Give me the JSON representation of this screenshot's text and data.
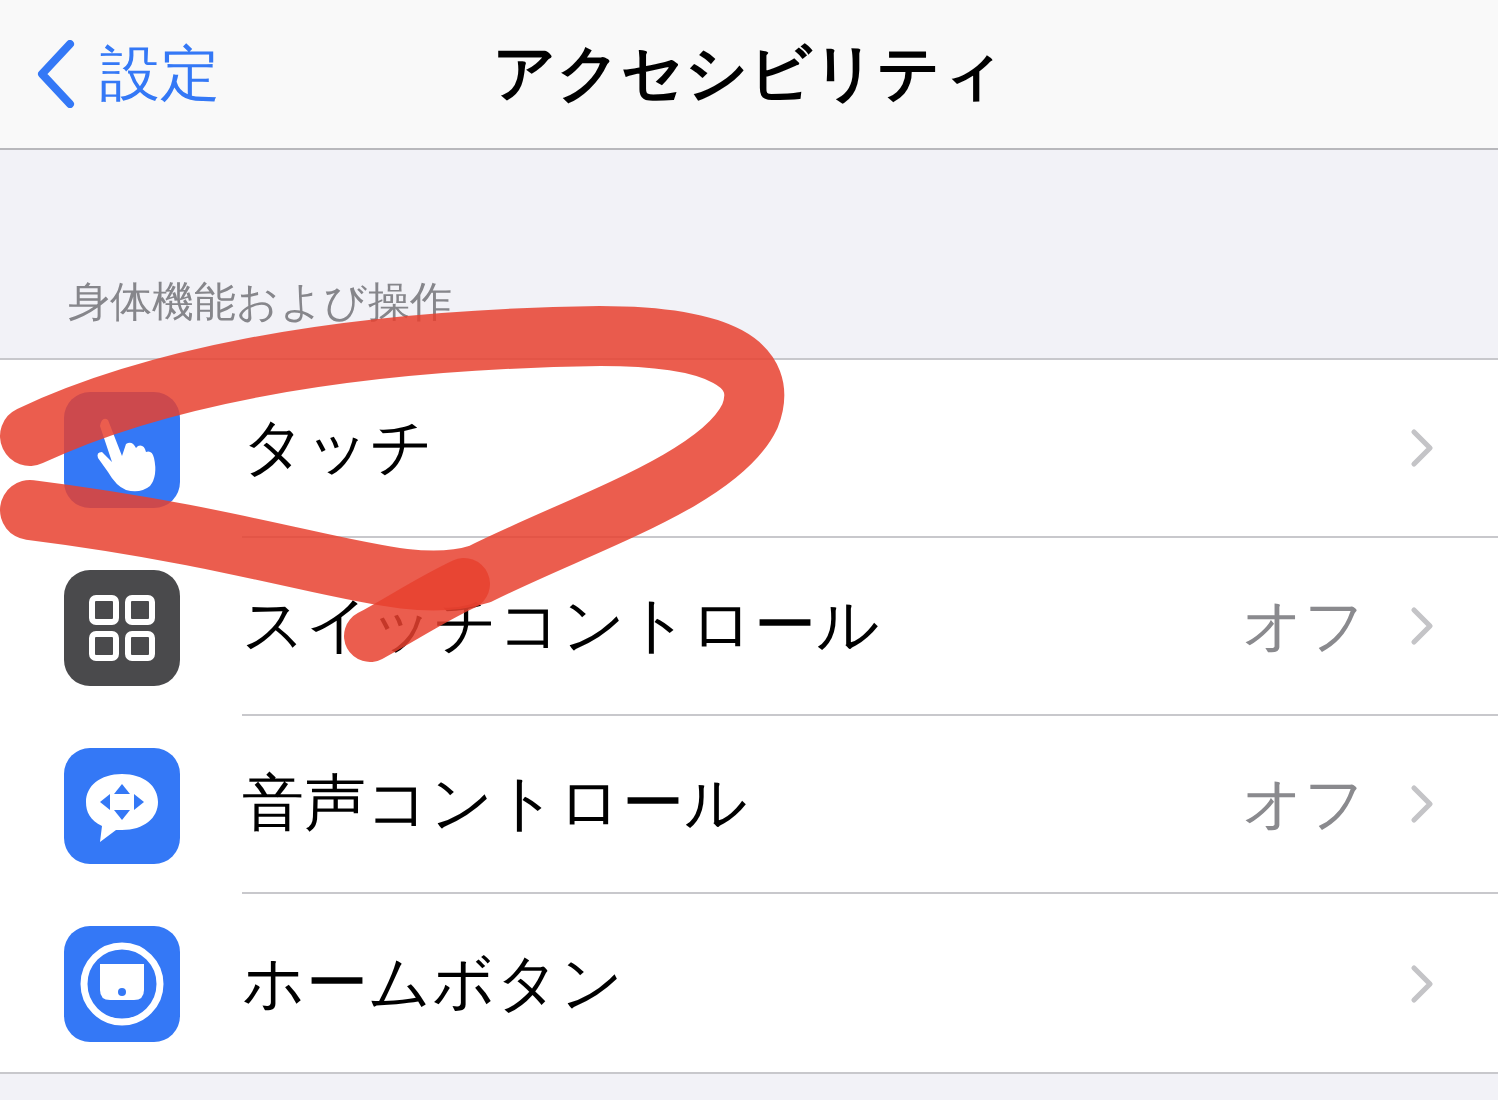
{
  "nav": {
    "back": "設定",
    "title": "アクセシビリティ"
  },
  "section": {
    "header": "身体機能および操作"
  },
  "items": [
    {
      "kind": "touch",
      "label": "タッチ"
    },
    {
      "kind": "switch",
      "label": "スイッチコントロール",
      "value": "オフ"
    },
    {
      "kind": "voice",
      "label": "音声コントロール",
      "value": "オフ"
    },
    {
      "kind": "home",
      "label": "ホームボタン"
    }
  ]
}
